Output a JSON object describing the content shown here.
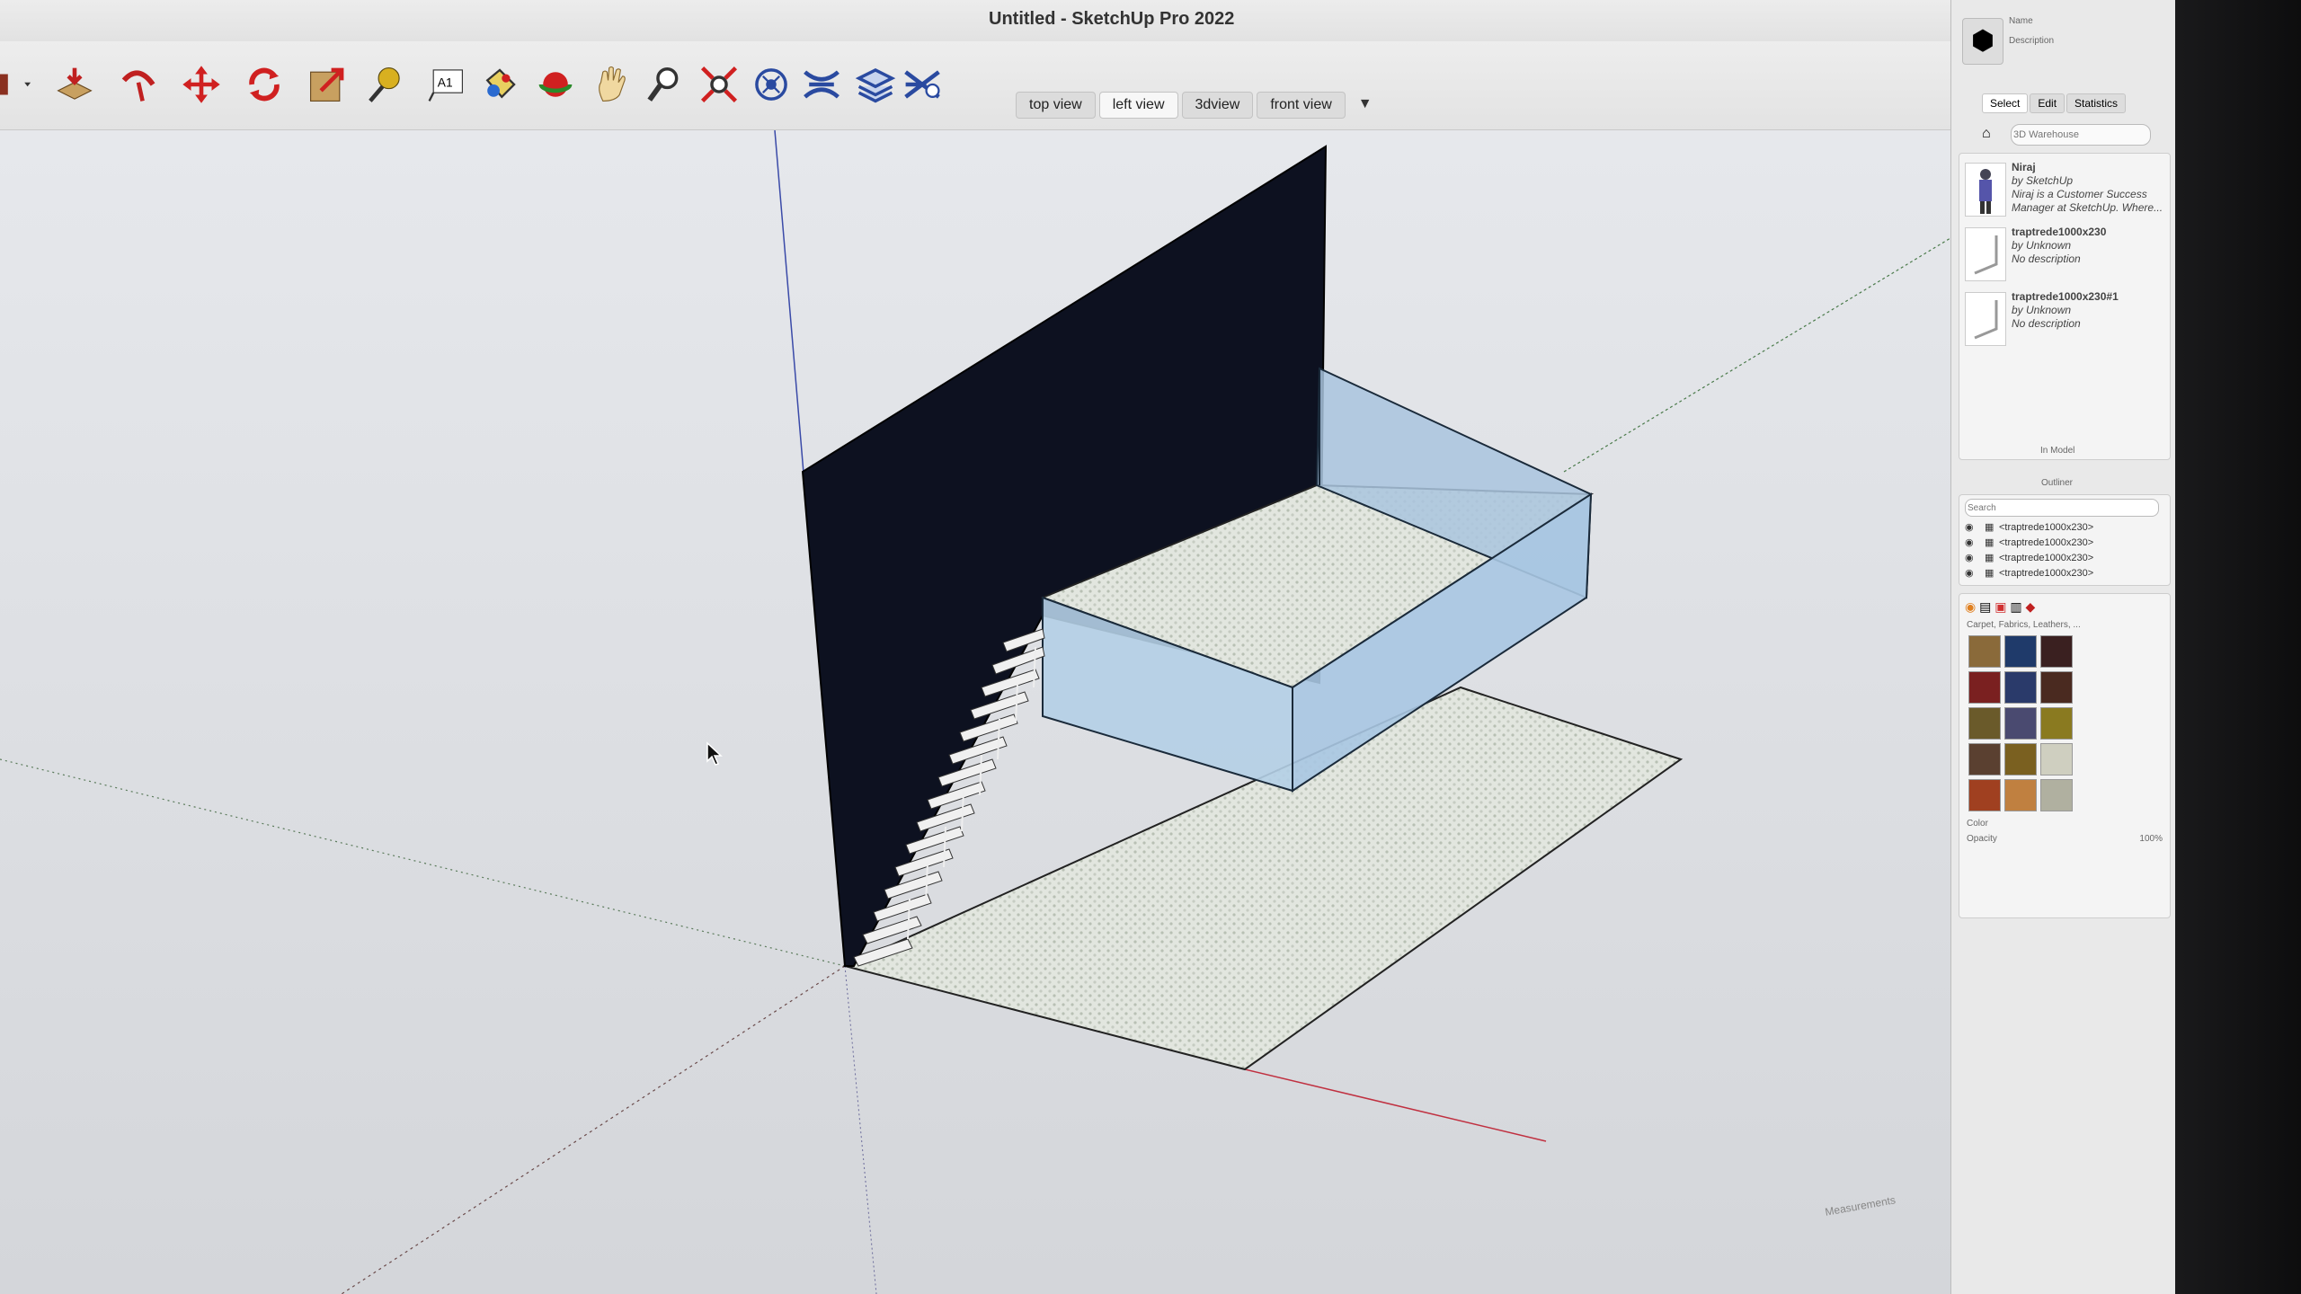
{
  "window": {
    "title": "Untitled - SketchUp Pro 2022"
  },
  "toolbar": {
    "tools": [
      {
        "name": "push-pull-icon"
      },
      {
        "name": "follow-me-icon"
      },
      {
        "name": "move-icon"
      },
      {
        "name": "rotate-icon"
      },
      {
        "name": "scale-icon"
      },
      {
        "name": "tape-measure-icon"
      },
      {
        "name": "text-icon",
        "glyph": "A1"
      },
      {
        "name": "paint-bucket-icon"
      },
      {
        "name": "orbit-icon"
      },
      {
        "name": "pan-icon"
      },
      {
        "name": "zoom-icon"
      },
      {
        "name": "zoom-extents-icon"
      },
      {
        "name": "geo-location-icon"
      },
      {
        "name": "sandbox-icon"
      },
      {
        "name": "layers-icon"
      },
      {
        "name": "extension-icon"
      }
    ]
  },
  "scenes": {
    "tabs": [
      {
        "label": "top view",
        "active": false
      },
      {
        "label": "left view",
        "active": true
      },
      {
        "label": "3dview",
        "active": false
      },
      {
        "label": "front view",
        "active": false
      }
    ],
    "menu_glyph": "▼"
  },
  "tray": {
    "entity": {
      "name_label": "Name",
      "desc_label": "Description"
    },
    "tabs": [
      {
        "label": "Select",
        "on": true
      },
      {
        "label": "Edit",
        "on": false
      },
      {
        "label": "Statistics",
        "on": false
      }
    ],
    "search_placeholder": "3D Warehouse",
    "components": [
      {
        "name": "Niraj",
        "by": "by SketchUp",
        "desc": "Niraj is a Customer Success Manager at SketchUp. Where..."
      },
      {
        "name": "traptrede1000x230",
        "by": "by Unknown",
        "desc": "No description"
      },
      {
        "name": "traptrede1000x230#1",
        "by": "by Unknown",
        "desc": "No description"
      }
    ],
    "in_model": "In Model",
    "outliner": {
      "title": "Outliner",
      "search_placeholder": "Search",
      "rows": [
        "<traptrede1000x230>",
        "<traptrede1000x230>",
        "<traptrede1000x230>",
        "<traptrede1000x230>"
      ]
    },
    "materials": {
      "library": "Carpet, Fabrics, Leathers, ...",
      "colors": [
        "#8a6a3a",
        "#1f3a6a",
        "#3a2020",
        "#7a2020",
        "#2a3a6a",
        "#4a2a20",
        "#6a5a2a",
        "#4a4a70",
        "#8a7a20",
        "#5a4030",
        "#7a6020",
        "#cfcfc0",
        "#a04020",
        "#c08040",
        "#b0b0a0"
      ],
      "color_label": "Color",
      "opacity_label": "Opacity",
      "opacity_value": "100%"
    },
    "measurements_label": "Measurements"
  }
}
